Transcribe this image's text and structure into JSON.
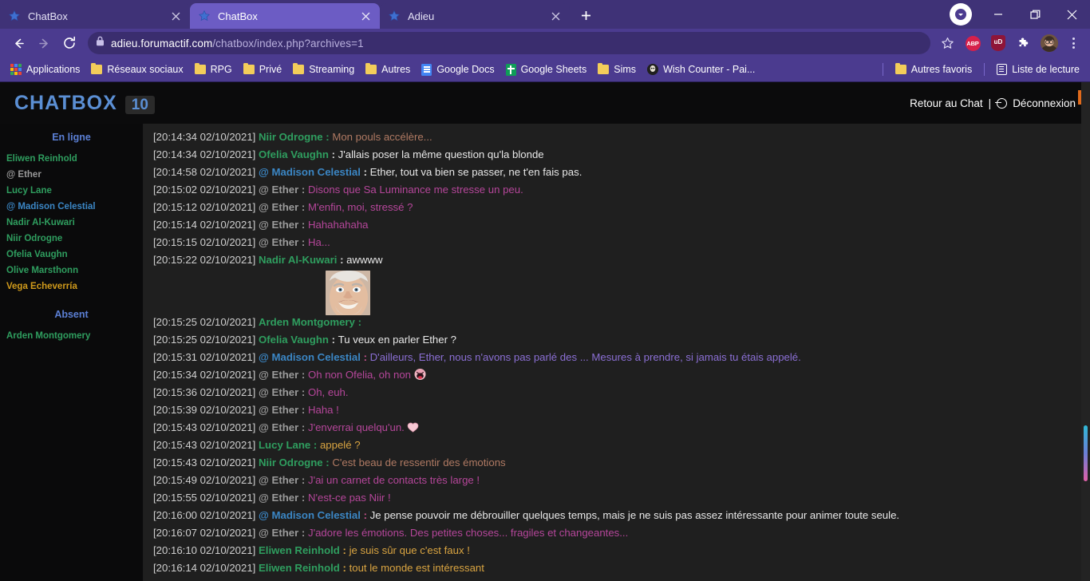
{
  "browser": {
    "tabs": [
      {
        "title": "ChatBox",
        "active": false,
        "favicon": "star-icon"
      },
      {
        "title": "ChatBox",
        "active": true,
        "favicon": "star-icon"
      },
      {
        "title": "Adieu",
        "active": false,
        "favicon": "star-icon"
      }
    ],
    "new_tab_label": "+",
    "window_controls": {
      "minimize": "—",
      "maximize": "❐",
      "close": "✕"
    },
    "nav": {
      "back": "back-arrow",
      "forward": "forward-arrow",
      "reload": "reload-arrow"
    },
    "address": {
      "lock": "lock-icon",
      "domain": "adieu.forumactif.com",
      "path": "/chatbox/index.php?archives=1",
      "full": "adieu.forumactif.com/chatbox/index.php?archives=1"
    },
    "extensions": [
      {
        "name": "adblock-plus",
        "label": "ABP"
      },
      {
        "name": "ublock",
        "label": "uD"
      },
      {
        "name": "extensions-puzzle",
        "label": ""
      },
      {
        "name": "profile-avatar",
        "label": ""
      }
    ],
    "bookmarks": [
      {
        "label": "Applications",
        "icon": "apps-grid-icon"
      },
      {
        "label": "Réseaux sociaux",
        "icon": "folder-icon"
      },
      {
        "label": "RPG",
        "icon": "folder-icon"
      },
      {
        "label": "Privé",
        "icon": "folder-icon"
      },
      {
        "label": "Streaming",
        "icon": "folder-icon"
      },
      {
        "label": "Autres",
        "icon": "folder-icon"
      },
      {
        "label": "Google Docs",
        "icon": "google-docs-icon"
      },
      {
        "label": "Google Sheets",
        "icon": "google-sheets-icon"
      },
      {
        "label": "Sims",
        "icon": "folder-icon"
      },
      {
        "label": "Wish Counter - Pai...",
        "icon": "site-icon"
      }
    ],
    "bookmarks_right": [
      {
        "label": "Autres favoris",
        "icon": "folder-icon"
      },
      {
        "label": "Liste de lecture",
        "icon": "reading-list-icon"
      }
    ]
  },
  "chatbox": {
    "title": "CHATBOX",
    "count": "10",
    "back_to_chat": "Retour au Chat",
    "separator": "|",
    "logout": "Déconnexion",
    "sidebar": {
      "online_heading": "En ligne",
      "online_users": [
        {
          "name": "Eliwen Reinhold",
          "color": "#2f9e5f"
        },
        {
          "name": "@ Ether",
          "color": "#9a9a9a"
        },
        {
          "name": "Lucy Lane",
          "color": "#2f9e5f"
        },
        {
          "name": "@ Madison Celestial",
          "color": "#3b86c4"
        },
        {
          "name": "Nadir Al-Kuwari",
          "color": "#2f9e5f"
        },
        {
          "name": "Niir Odrogne",
          "color": "#2f9e5f"
        },
        {
          "name": "Ofelia Vaughn",
          "color": "#2f9e5f"
        },
        {
          "name": "Olive Marsthonn",
          "color": "#2f9e5f"
        },
        {
          "name": "Vega Echeverría",
          "color": "#d09a1b"
        }
      ],
      "away_heading": "Absent",
      "away_users": [
        {
          "name": "Arden Montgomery",
          "color": "#2f9e5f"
        }
      ]
    },
    "messages": [
      {
        "ts": "[20:14:34 02/10/2021]",
        "user": "Niir Odrogne",
        "user_color": "#2f9e5f",
        "colon": ":",
        "colon_color": "#2f9e5f",
        "text": "Mon pouls accélère...",
        "text_color": "#b07a63",
        "avatar": false,
        "emoji": ""
      },
      {
        "ts": "[20:14:34 02/10/2021]",
        "user": "Ofelia Vaughn",
        "user_color": "#2f9e5f",
        "colon": ":",
        "colon_color": "#d7d7d7",
        "text": "J'allais poser la même question qu'la blonde",
        "text_color": "#e8e8e8",
        "avatar": false,
        "emoji": ""
      },
      {
        "ts": "[20:14:58 02/10/2021]",
        "user": "@ Madison Celestial",
        "user_color": "#3b86c4",
        "colon": ":",
        "colon_color": "#e8e8e8",
        "text": "Ether, tout va bien se passer, ne t'en fais pas.",
        "text_color": "#e8e8e8",
        "avatar": false,
        "emoji": ""
      },
      {
        "ts": "[20:15:02 02/10/2021]",
        "user": "@ Ether",
        "user_color": "#9a9a9a",
        "colon": ":",
        "colon_color": "#9a9a9a",
        "text": "Disons que Sa Luminance me stresse un peu.",
        "text_color": "#b5469a",
        "avatar": false,
        "emoji": ""
      },
      {
        "ts": "[20:15:12 02/10/2021]",
        "user": "@ Ether",
        "user_color": "#9a9a9a",
        "colon": ":",
        "colon_color": "#9a9a9a",
        "text": "M'enfin, moi, stressé ?",
        "text_color": "#b5469a",
        "avatar": false,
        "emoji": ""
      },
      {
        "ts": "[20:15:14 02/10/2021]",
        "user": "@ Ether",
        "user_color": "#9a9a9a",
        "colon": ":",
        "colon_color": "#9a9a9a",
        "text": "Hahahahaha",
        "text_color": "#b5469a",
        "avatar": false,
        "emoji": ""
      },
      {
        "ts": "[20:15:15 02/10/2021]",
        "user": "@ Ether",
        "user_color": "#9a9a9a",
        "colon": ":",
        "colon_color": "#9a9a9a",
        "text": "Ha...",
        "text_color": "#b5469a",
        "avatar": false,
        "emoji": ""
      },
      {
        "ts": "[20:15:22 02/10/2021]",
        "user": "Nadir Al-Kuwari",
        "user_color": "#2f9e5f",
        "colon": ":",
        "colon_color": "#d7d7d7",
        "text": "awwww",
        "text_color": "#e8e8e8",
        "avatar": false,
        "emoji": ""
      },
      {
        "ts": "[20:15:25 02/10/2021]",
        "user": "Arden Montgomery",
        "user_color": "#2f9e5f",
        "colon": ":",
        "colon_color": "#2f9e5f",
        "text": "",
        "text_color": "#e8e8e8",
        "avatar": true,
        "emoji": ""
      },
      {
        "ts": "[20:15:25 02/10/2021]",
        "user": "Ofelia Vaughn",
        "user_color": "#2f9e5f",
        "colon": ":",
        "colon_color": "#d7d7d7",
        "text": "Tu veux en parler Ether ?",
        "text_color": "#e8e8e8",
        "avatar": false,
        "emoji": ""
      },
      {
        "ts": "[20:15:31 02/10/2021]",
        "user": "@ Madison Celestial",
        "user_color": "#3b86c4",
        "colon": ":",
        "colon_color": "#c9548f",
        "text": "D'ailleurs, Ether, nous n'avons pas parlé des ... Mesures à prendre, si jamais tu étais appelé.",
        "text_color": "#8b6fd4",
        "avatar": false,
        "emoji": ""
      },
      {
        "ts": "[20:15:34 02/10/2021]",
        "user": "@ Ether",
        "user_color": "#9a9a9a",
        "colon": ":",
        "colon_color": "#9a9a9a",
        "text": "Oh non Ofelia, oh non",
        "text_color": "#b5469a",
        "avatar": false,
        "emoji": "laughing-face-emoji"
      },
      {
        "ts": "[20:15:36 02/10/2021]",
        "user": "@ Ether",
        "user_color": "#9a9a9a",
        "colon": ":",
        "colon_color": "#9a9a9a",
        "text": "Oh, euh.",
        "text_color": "#b5469a",
        "avatar": false,
        "emoji": ""
      },
      {
        "ts": "[20:15:39 02/10/2021]",
        "user": "@ Ether",
        "user_color": "#9a9a9a",
        "colon": ":",
        "colon_color": "#9a9a9a",
        "text": "Haha !",
        "text_color": "#b5469a",
        "avatar": false,
        "emoji": ""
      },
      {
        "ts": "[20:15:43 02/10/2021]",
        "user": "@ Ether",
        "user_color": "#9a9a9a",
        "colon": ":",
        "colon_color": "#9a9a9a",
        "text": "J'enverrai quelqu'un.",
        "text_color": "#b5469a",
        "avatar": false,
        "emoji": "heart-emoji"
      },
      {
        "ts": "[20:15:43 02/10/2021]",
        "user": "Lucy Lane",
        "user_color": "#2f9e5f",
        "colon": ":",
        "colon_color": "#2f9e5f",
        "text": "appelé ?",
        "text_color": "#d9a441",
        "avatar": false,
        "emoji": ""
      },
      {
        "ts": "[20:15:43 02/10/2021]",
        "user": "Niir Odrogne",
        "user_color": "#2f9e5f",
        "colon": ":",
        "colon_color": "#2f9e5f",
        "text": "C'est beau de ressentir des émotions",
        "text_color": "#b07a63",
        "avatar": false,
        "emoji": ""
      },
      {
        "ts": "[20:15:49 02/10/2021]",
        "user": "@ Ether",
        "user_color": "#9a9a9a",
        "colon": ":",
        "colon_color": "#9a9a9a",
        "text": "J'ai un carnet de contacts très large !",
        "text_color": "#b5469a",
        "avatar": false,
        "emoji": ""
      },
      {
        "ts": "[20:15:55 02/10/2021]",
        "user": "@ Ether",
        "user_color": "#9a9a9a",
        "colon": ":",
        "colon_color": "#9a9a9a",
        "text": "N'est-ce pas Niir !",
        "text_color": "#b5469a",
        "avatar": false,
        "emoji": ""
      },
      {
        "ts": "[20:16:00 02/10/2021]",
        "user": "@ Madison Celestial",
        "user_color": "#3b86c4",
        "colon": ":",
        "colon_color": "#c9548f",
        "text": "Je pense pouvoir me débrouiller quelques temps, mais je ne suis pas assez intéressante pour animer toute seule.",
        "text_color": "#e8e8e8",
        "avatar": false,
        "emoji": ""
      },
      {
        "ts": "[20:16:07 02/10/2021]",
        "user": "@ Ether",
        "user_color": "#9a9a9a",
        "colon": ":",
        "colon_color": "#9a9a9a",
        "text": "J'adore les émotions. Des petites choses... fragiles et changeantes...",
        "text_color": "#b5469a",
        "avatar": false,
        "emoji": ""
      },
      {
        "ts": "[20:16:10 02/10/2021]",
        "user": "Eliwen Reinhold",
        "user_color": "#2f9e5f",
        "colon": ":",
        "colon_color": "#d7a441",
        "text": "je suis sûr que c'est faux !",
        "text_color": "#d9a441",
        "avatar": false,
        "emoji": ""
      },
      {
        "ts": "[20:16:14 02/10/2021]",
        "user": "Eliwen Reinhold",
        "user_color": "#2f9e5f",
        "colon": ":",
        "colon_color": "#d7a441",
        "text": "tout le monde est intéressant",
        "text_color": "#d9a441",
        "avatar": false,
        "emoji": ""
      }
    ]
  }
}
